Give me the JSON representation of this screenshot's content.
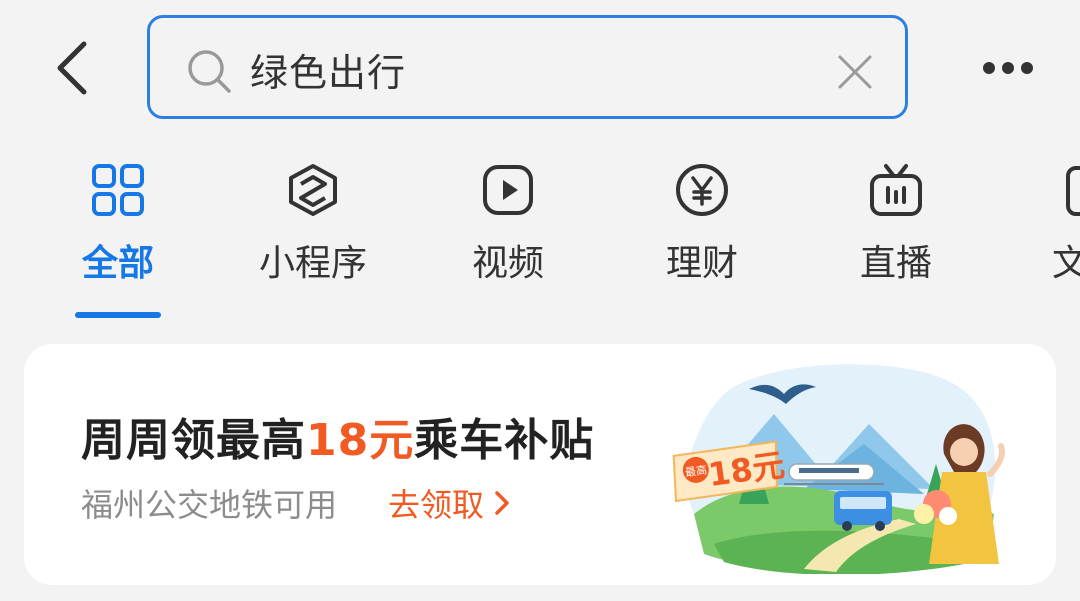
{
  "search": {
    "query": "绿色出行"
  },
  "tabs": [
    {
      "label": "全部",
      "icon": "grid-icon",
      "active": true
    },
    {
      "label": "小程序",
      "icon": "mini-program-icon",
      "active": false
    },
    {
      "label": "视频",
      "icon": "video-play-icon",
      "active": false
    },
    {
      "label": "理财",
      "icon": "yen-icon",
      "active": false
    },
    {
      "label": "直播",
      "icon": "tv-live-icon",
      "active": false
    },
    {
      "label": "文",
      "icon": "article-icon",
      "active": false
    }
  ],
  "promo": {
    "title_prefix": "周周领最高",
    "title_amount": "18元",
    "title_suffix": "乘车补贴",
    "subtitle": "福州公交地铁可用",
    "cta": "去领取",
    "badge_small": "最高",
    "badge_amount": "18元"
  },
  "colors": {
    "accent_blue": "#1677e6",
    "promo_orange": "#f15a22",
    "background": "#f3f3f3"
  }
}
